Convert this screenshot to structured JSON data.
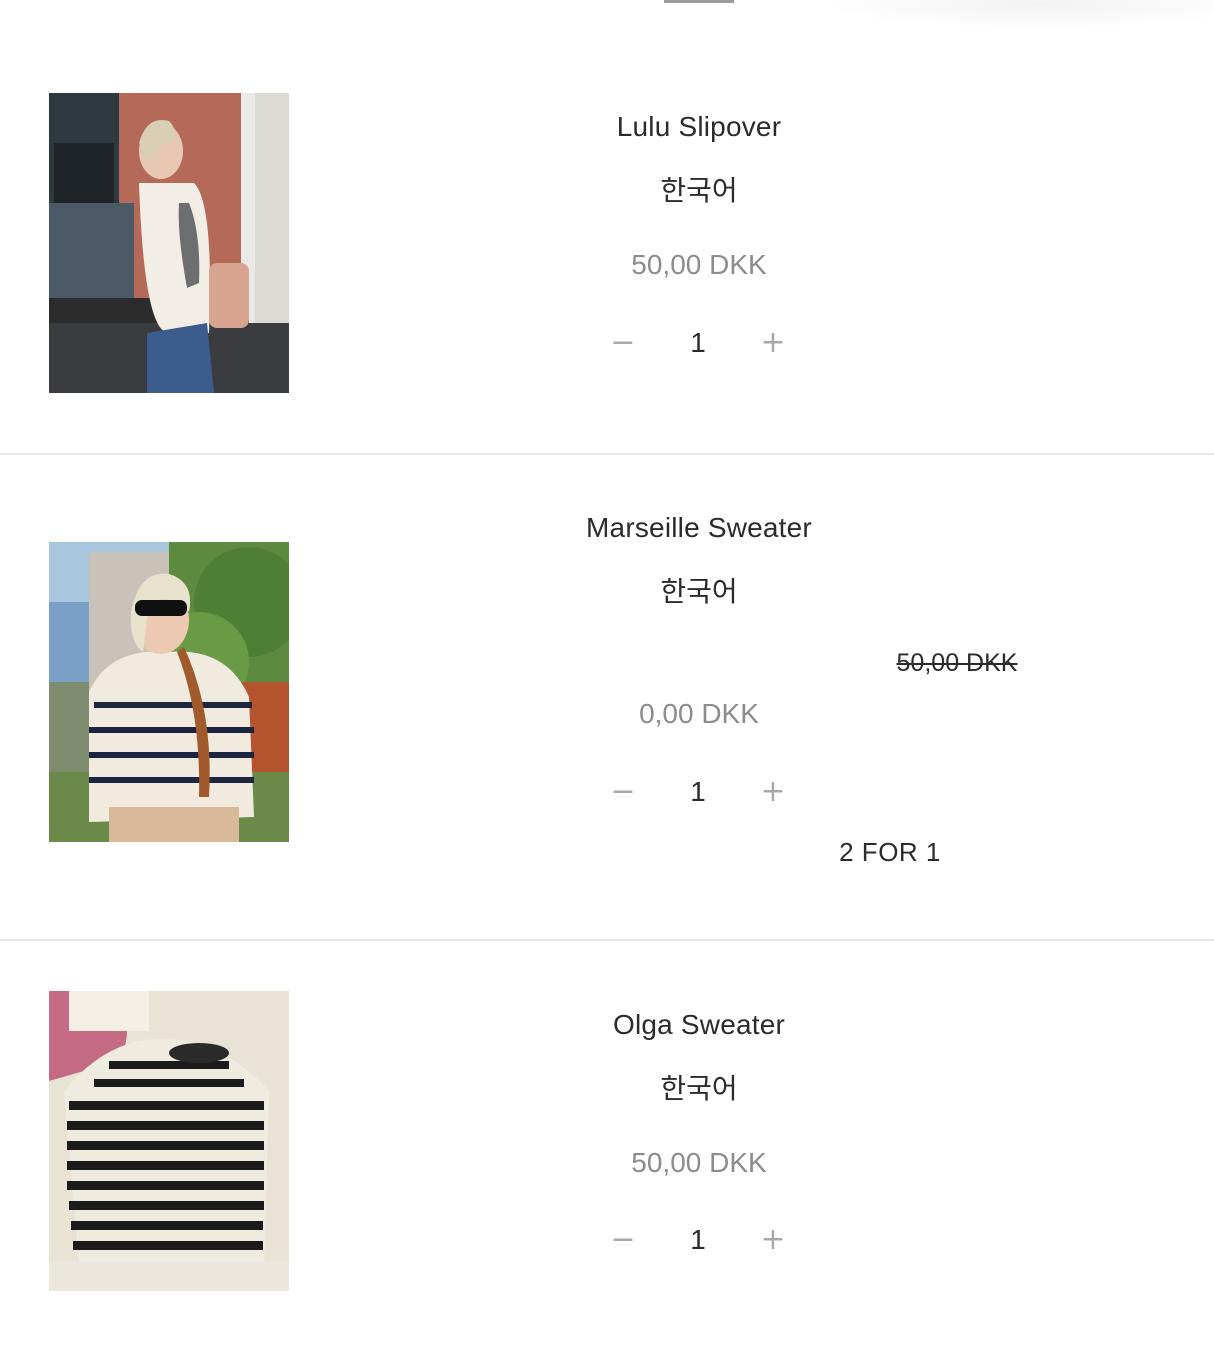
{
  "items": [
    {
      "title": "Lulu Slipover",
      "language": "한국어",
      "price": "50,00 DKK",
      "quantity": "1",
      "minus_label": "−",
      "plus_label": "+",
      "image_alt": "Woman wearing a cream knitted slipover over a grey top"
    },
    {
      "title": "Marseille Sweater",
      "language": "한국어",
      "original_price": "50,00 DKK",
      "price": "0,00 DKK",
      "quantity": "1",
      "minus_label": "−",
      "plus_label": "+",
      "promo": "2 FOR 1",
      "image_alt": "Woman in sunglasses wearing a cream sweater with navy stripes"
    },
    {
      "title": "Olga Sweater",
      "language": "한국어",
      "price": "50,00 DKK",
      "quantity": "1",
      "minus_label": "−",
      "plus_label": "+",
      "image_alt": "Black and cream striped sweater laid flat on a bed"
    }
  ],
  "colors": {
    "text": "#2b2b2b",
    "muted_price": "#8c8c8c",
    "stepper": "#a8a8a8",
    "divider": "#e6e6e6"
  }
}
